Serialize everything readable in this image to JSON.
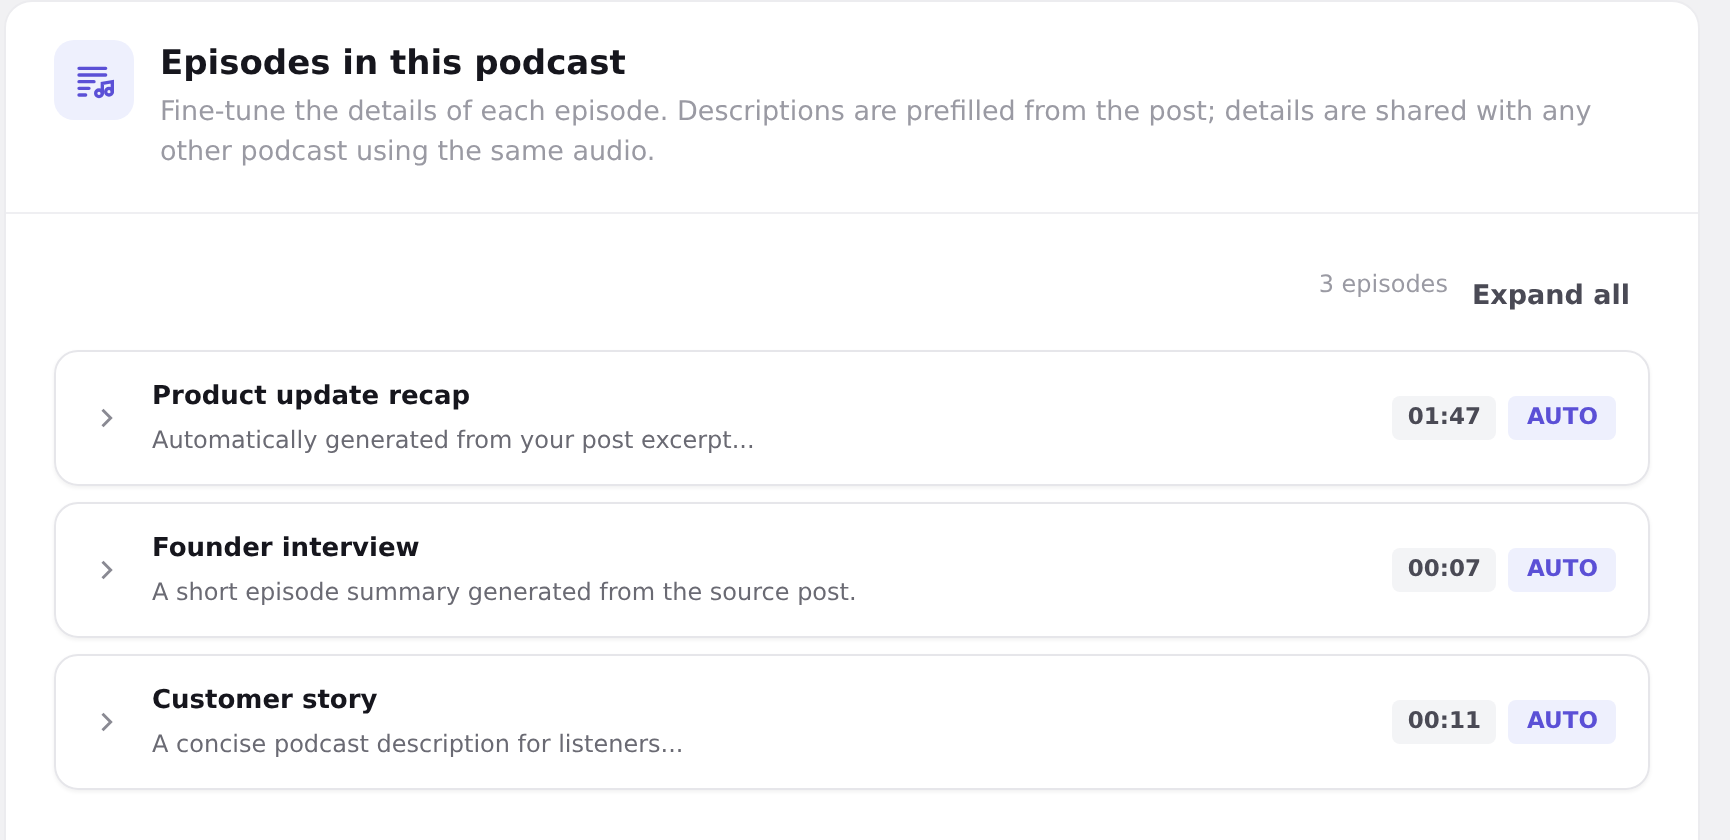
{
  "header": {
    "title": "Episodes in this podcast",
    "description": "Fine-tune the details of each episode. Descriptions are prefilled from the post; details are shared with any other podcast using the same audio."
  },
  "toolbar": {
    "count": "3 episodes",
    "expand_button": "Expand all"
  },
  "episodes": [
    {
      "title": "Product update recap",
      "summary": "Automatically generated from your post excerpt...",
      "duration": "01:47",
      "badge": "AUTO",
      "expanded": false
    },
    {
      "title": "Founder interview",
      "summary": "A short episode summary generated from the source post.",
      "duration": "00:07",
      "badge": "AUTO",
      "expanded": false
    },
    {
      "title": "Customer story",
      "summary": "A concise podcast description for listeners...",
      "duration": "00:11",
      "badge": "AUTO",
      "expanded": false
    }
  ]
}
